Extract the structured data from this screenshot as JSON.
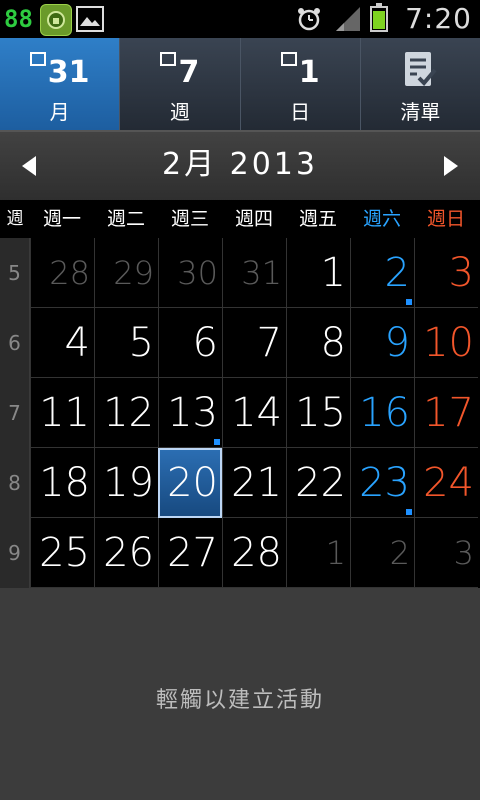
{
  "statusbar": {
    "left_number": "88",
    "time": "7:20",
    "icons": [
      "app-badge-icon",
      "lock-app-icon",
      "image-icon",
      "alarm-icon",
      "signal-icon",
      "battery-icon"
    ],
    "battery_color": "#7ed321"
  },
  "tabs": [
    {
      "icon_number": "31",
      "label": "月",
      "active": true
    },
    {
      "icon_number": "7",
      "label": "週",
      "active": false
    },
    {
      "icon_number": "1",
      "label": "日",
      "active": false
    },
    {
      "icon_number": "",
      "label": "清單",
      "active": false
    }
  ],
  "month_header": {
    "title": "2月 2013"
  },
  "weekdays": {
    "week_label": "週",
    "days": [
      "週一",
      "週二",
      "週三",
      "週四",
      "週五",
      "週六",
      "週日"
    ]
  },
  "weeks": [
    {
      "week": "5",
      "days": [
        "28",
        "29",
        "30",
        "31",
        "1",
        "2",
        "3"
      ]
    },
    {
      "week": "6",
      "days": [
        "4",
        "5",
        "6",
        "7",
        "8",
        "9",
        "10"
      ]
    },
    {
      "week": "7",
      "days": [
        "11",
        "12",
        "13",
        "14",
        "15",
        "16",
        "17"
      ]
    },
    {
      "week": "8",
      "days": [
        "18",
        "19",
        "20",
        "21",
        "22",
        "23",
        "24"
      ]
    },
    {
      "week": "9",
      "days": [
        "25",
        "26",
        "27",
        "28",
        "1",
        "2",
        "3"
      ]
    }
  ],
  "empty_state_text": "輕觸以建立活動",
  "colors": {
    "saturday": "#29a3ff",
    "sunday": "#f2562b",
    "active_tab": "#2f7fc8",
    "today": "#2c6fb4"
  }
}
